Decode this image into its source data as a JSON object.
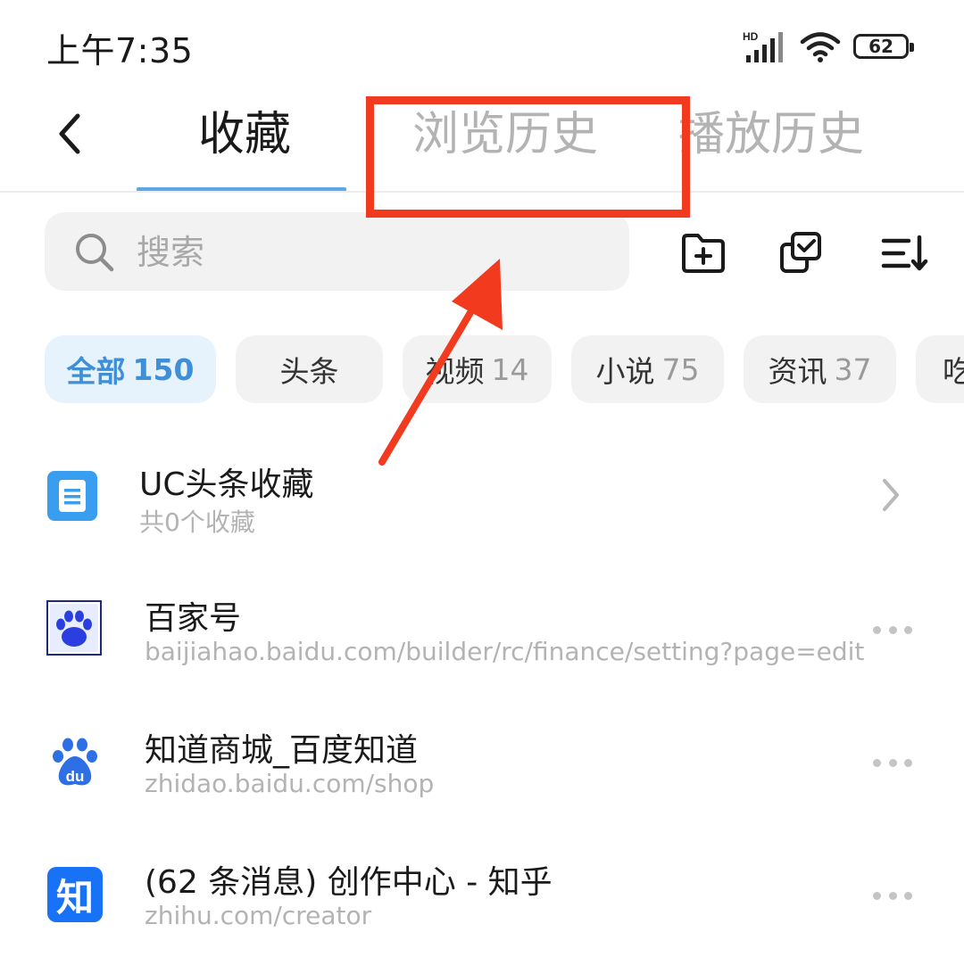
{
  "status_bar": {
    "time": "上午7:35",
    "network_label": "HD",
    "battery": "62"
  },
  "tabs": [
    {
      "label": "收藏",
      "active": true
    },
    {
      "label": "浏览历史",
      "active": false
    },
    {
      "label": "播放历史",
      "active": false
    }
  ],
  "search": {
    "placeholder": "搜索"
  },
  "toolbar": {
    "icons": [
      "new-folder-icon",
      "multi-select-icon",
      "sort-icon"
    ]
  },
  "filters": [
    {
      "label": "全部",
      "count": "150",
      "active": true
    },
    {
      "label": "头条",
      "count": "",
      "active": false
    },
    {
      "label": "视频",
      "count": "14",
      "active": false
    },
    {
      "label": "小说",
      "count": "75",
      "active": false
    },
    {
      "label": "资讯",
      "count": "37",
      "active": false
    },
    {
      "label": "吃",
      "count": "",
      "active": false
    }
  ],
  "items": [
    {
      "title": "UC头条收藏",
      "subtitle": "共0个收藏",
      "icon": "document-icon",
      "action": "chevron-right-icon"
    },
    {
      "title": "百家号",
      "subtitle": "baijiahao.baidu.com/builder/rc/finance/setting?page=edit",
      "icon": "paw-icon",
      "action": "more-icon"
    },
    {
      "title": "知道商城_百度知道",
      "subtitle": "zhidao.baidu.com/shop",
      "icon": "baidu-icon",
      "action": "more-icon"
    },
    {
      "title": "(62 条消息) 创作中心 - 知乎",
      "subtitle": "zhihu.com/creator",
      "icon": "zhihu-icon",
      "action": "more-icon"
    }
  ],
  "logos": {
    "baidu_du": "du",
    "zhihu_zhi": "知"
  },
  "colors": {
    "accent": "#5aa9e6",
    "annotation": "#f23a1f",
    "chip_active_bg": "#e6f2fc",
    "muted_text": "#b3b3b3"
  }
}
